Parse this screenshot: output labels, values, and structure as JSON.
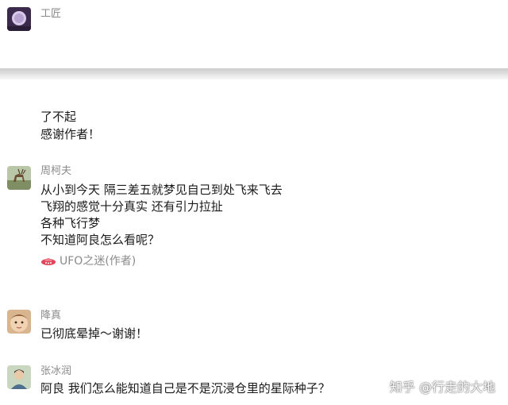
{
  "comments": [
    {
      "username": "工匠",
      "lines": []
    },
    {
      "username": "",
      "lines": [
        "了不起",
        "感谢作者！"
      ]
    },
    {
      "username": "周柯夫",
      "lines": [
        "从小到今天 隔三差五就梦见自己到处飞来飞去",
        "飞翔的感觉十分真实 还有引力拉扯",
        "各种飞行梦",
        "不知道阿良怎么看呢？"
      ]
    },
    {
      "username": "降真",
      "lines": [
        "已彻底晕掉～谢谢！"
      ]
    },
    {
      "username": "张冰润",
      "lines": [
        "阿良 我们怎么能知道自己是不是沉浸仓里的星际种子？"
      ]
    }
  ],
  "author_reply": {
    "name": "UFO之迷(作者)",
    "icon": "ufo-icon"
  },
  "watermark": "知乎 @行走的大地",
  "colors": {
    "divider": "#dcdcdc",
    "username": "#8a8a8a",
    "text": "#1a1a1a",
    "background": "#ffffff"
  }
}
